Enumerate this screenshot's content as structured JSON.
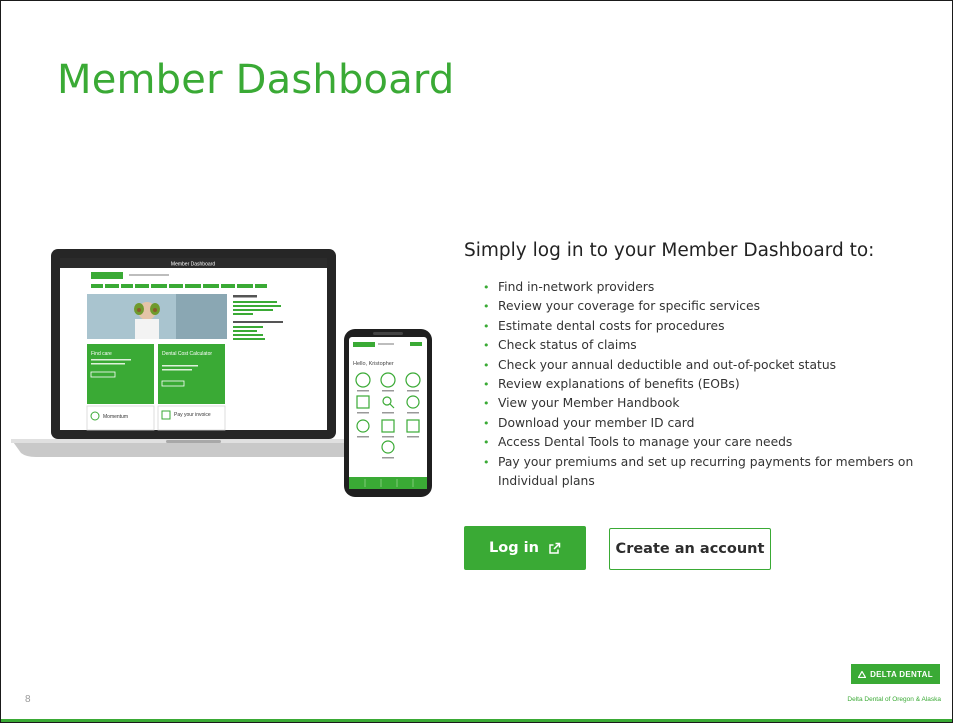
{
  "slide": {
    "title": "Member Dashboard",
    "page_number": "8"
  },
  "content": {
    "heading": "Simply log in to your Member Dashboard to:",
    "items": [
      "Find in-network providers",
      "Review your coverage for specific services",
      "Estimate dental costs for procedures",
      "Check status of claims",
      "Check your annual deductible and out-of-pocket status",
      "Review explanations of benefits (EOBs)",
      "View your Member Handbook",
      "Download your member ID card",
      "Access Dental Tools to manage your care needs",
      "Pay your premiums and set up recurring payments for members on Individual plans"
    ]
  },
  "buttons": {
    "login_label": "Log in",
    "create_account_label": "Create an account"
  },
  "brand": {
    "logo_text": "DELTA DENTAL",
    "caption": "Delta Dental of Oregon & Alaska",
    "accent": "#3aaa35"
  },
  "illustration": {
    "laptop_header": "Member Dashboard",
    "card_find_care": "Find care",
    "card_cost_calc": "Dental Cost Calculator",
    "card_momentum": "Momentum",
    "card_pay": "Pay your invoice",
    "phone_greeting": "Hello, Kristopher"
  },
  "icons": {
    "login_icon": "external-link-icon",
    "logo_icon": "delta-triangle-icon"
  }
}
